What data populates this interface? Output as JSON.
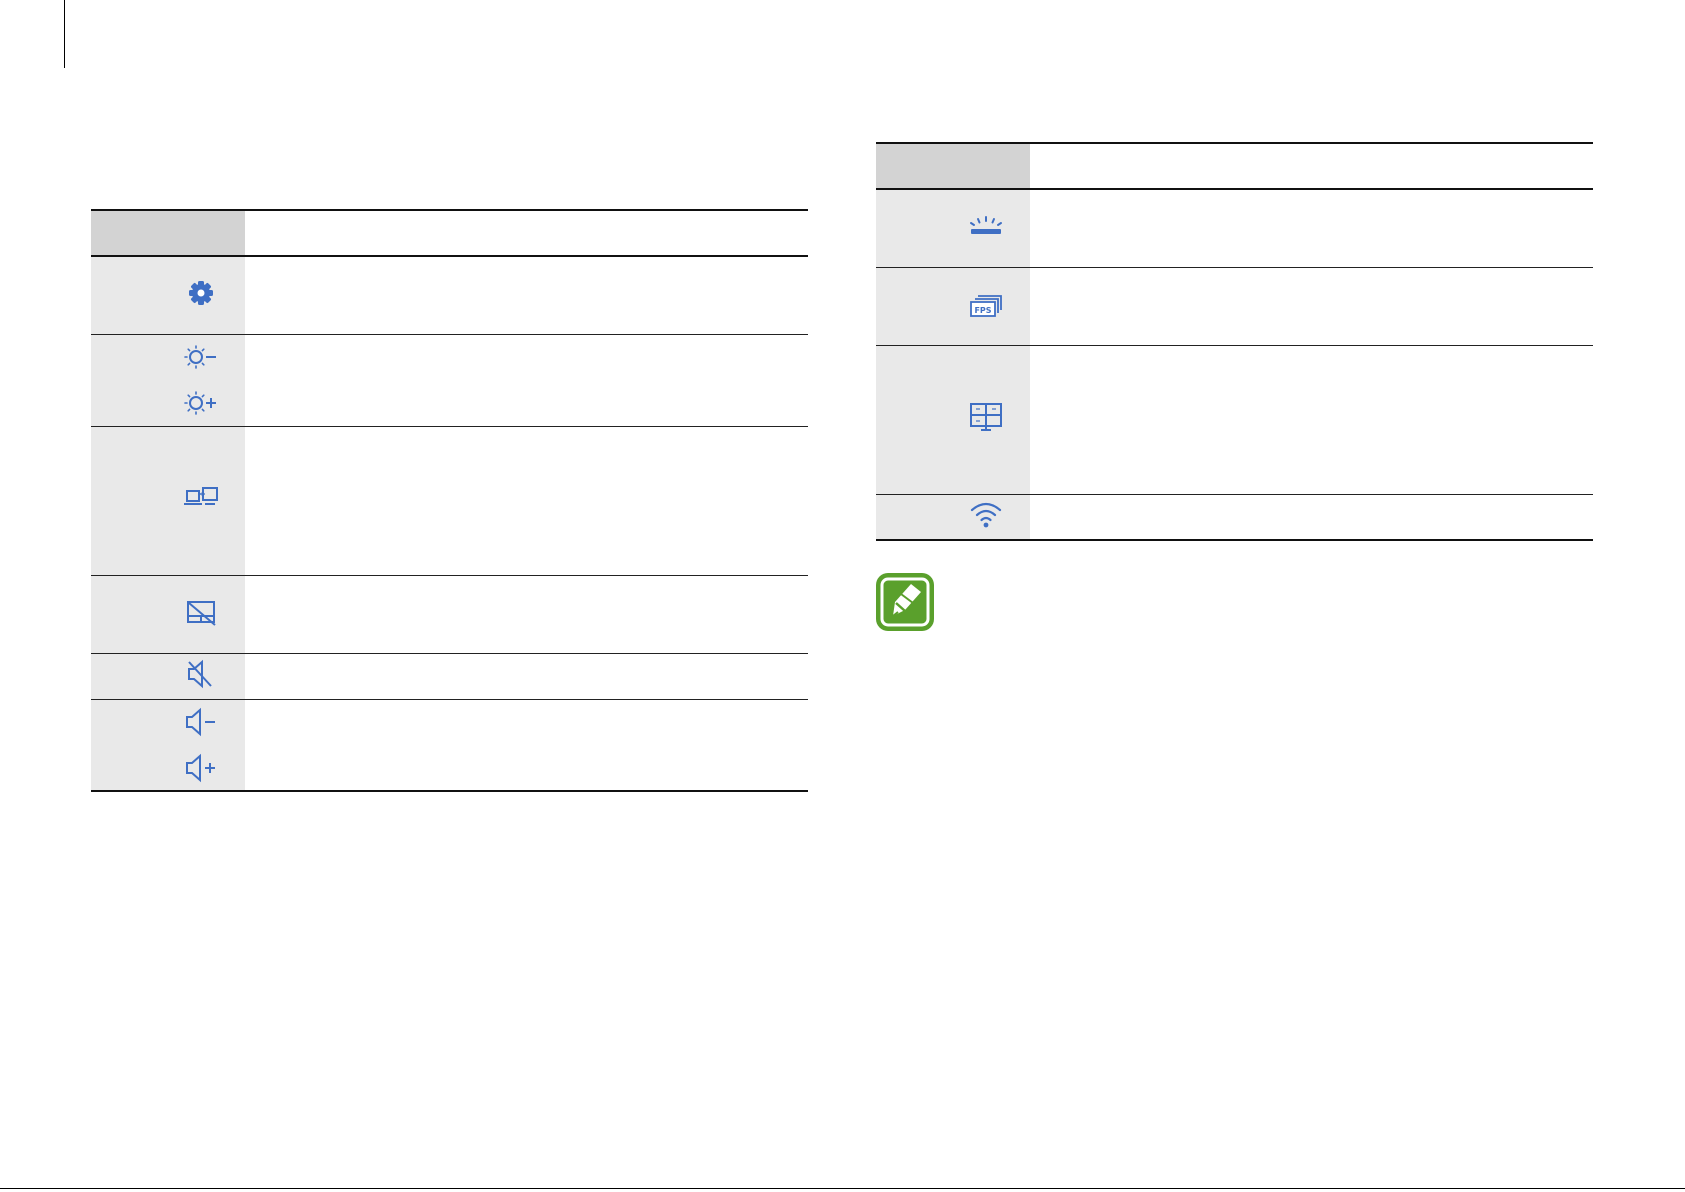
{
  "left_table": {
    "rows": [
      {
        "icons": [
          "settings-gear-icon"
        ]
      },
      {
        "icons": [
          "brightness-down-icon",
          "brightness-up-icon"
        ]
      },
      {
        "icons": [
          "display-switch-icon"
        ]
      },
      {
        "icons": [
          "touchpad-off-icon"
        ]
      },
      {
        "icons": [
          "mute-icon"
        ]
      },
      {
        "icons": [
          "volume-down-icon",
          "volume-up-icon"
        ]
      }
    ]
  },
  "right_table": {
    "rows": [
      {
        "icons": [
          "keyboard-backlight-icon"
        ]
      },
      {
        "icons": [
          "fps-icon"
        ]
      },
      {
        "icons": [
          "display-layout-icon"
        ]
      },
      {
        "icons": [
          "wifi-icon"
        ]
      }
    ]
  },
  "note": {
    "icon": "note-pencil-icon"
  },
  "colors": {
    "icon_blue": "#3f6fc4",
    "note_green": "#5aa02c",
    "key_cell": "#e9e9e9",
    "header_cell": "#d3d3d3"
  }
}
